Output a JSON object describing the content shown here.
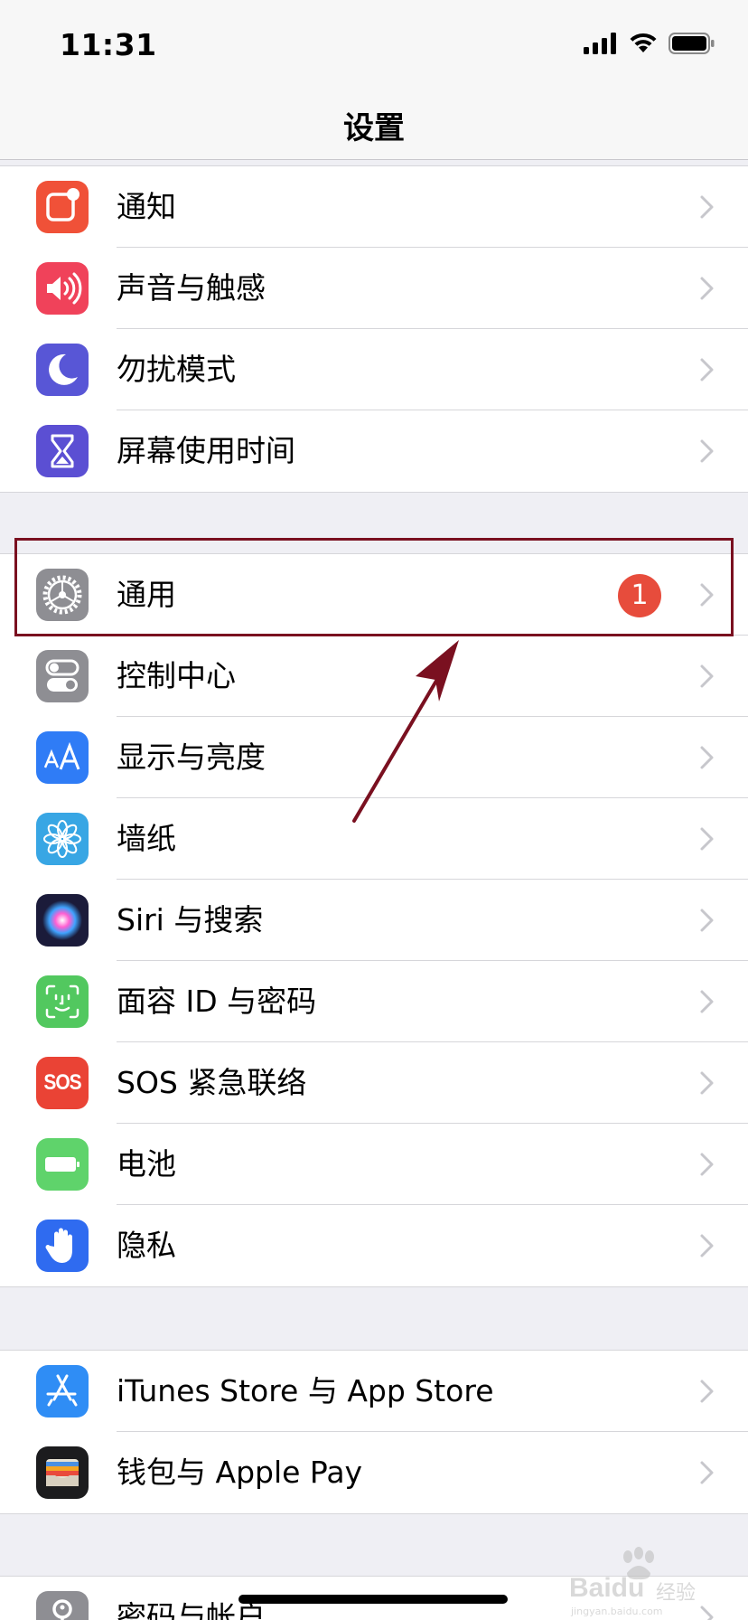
{
  "status_bar": {
    "time": "11:31"
  },
  "nav": {
    "title": "设置"
  },
  "groups": [
    {
      "items": [
        {
          "label": "通知",
          "icon": "notifications-icon",
          "color": "#f05138"
        },
        {
          "label": "声音与触感",
          "icon": "sound-icon",
          "color": "#f0425a"
        },
        {
          "label": "勿扰模式",
          "icon": "moon-icon",
          "color": "#5856d6"
        },
        {
          "label": "屏幕使用时间",
          "icon": "hourglass-icon",
          "color": "#5b4fd3"
        }
      ]
    },
    {
      "items": [
        {
          "label": "通用",
          "icon": "gear-icon",
          "color": "#8e8e93",
          "badge": "1"
        },
        {
          "label": "控制中心",
          "icon": "toggles-icon",
          "color": "#8e8e93"
        },
        {
          "label": "显示与亮度",
          "icon": "text-size-icon",
          "color": "#2f7cf6"
        },
        {
          "label": "墙纸",
          "icon": "flower-icon",
          "color": "#38a6e4"
        },
        {
          "label": "Siri 与搜索",
          "icon": "siri-icon",
          "color": "#1b1b3a"
        },
        {
          "label": "面容 ID 与密码",
          "icon": "face-id-icon",
          "color": "#52c85f"
        },
        {
          "label": "SOS 紧急联络",
          "icon": "sos-icon",
          "color": "#ea4335",
          "icon_text": "SOS"
        },
        {
          "label": "电池",
          "icon": "battery-icon",
          "color": "#5fd36b"
        },
        {
          "label": "隐私",
          "icon": "hand-icon",
          "color": "#2f6bf0"
        }
      ]
    },
    {
      "items": [
        {
          "label": "iTunes Store 与 App Store",
          "icon": "app-store-icon",
          "color": "#2f8df5"
        },
        {
          "label": "钱包与 Apple Pay",
          "icon": "wallet-icon",
          "color": "#1c1c1e"
        }
      ]
    },
    {
      "items": [
        {
          "label": "密码与帐户",
          "icon": "key-icon",
          "color": "#8e8e93"
        }
      ]
    }
  ],
  "watermark": {
    "brand": "Baidu",
    "brand_cn": "经验",
    "url": "jingyan.baidu.com"
  },
  "colors": {
    "annotation": "#7a1020",
    "badge": "#e74c3c",
    "chevron": "#c7c7cc"
  }
}
